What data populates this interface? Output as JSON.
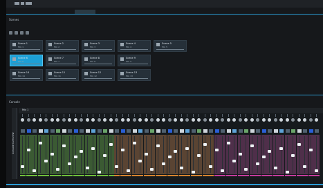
{
  "titlebar": {
    "logo": "logo-icon"
  },
  "tabs": [
    {
      "label": "",
      "active": false
    },
    {
      "label": "",
      "active": false
    },
    {
      "label": "",
      "active": false
    },
    {
      "label": "",
      "active": true
    }
  ],
  "upper": {
    "title": "Scenes",
    "toolbar": [
      "",
      "",
      "",
      "",
      "",
      "",
      "",
      ""
    ],
    "cards": [
      {
        "name": "Scene 1",
        "sub": "Mix 1",
        "selected": false
      },
      {
        "name": "Scene 2",
        "sub": "Mix 2",
        "selected": false
      },
      {
        "name": "Scene 3",
        "sub": "Mix 3",
        "selected": false
      },
      {
        "name": "Scene 4",
        "sub": "Mix 4",
        "selected": false
      },
      {
        "name": "Scene 5",
        "sub": "Mix 5",
        "selected": false
      },
      {
        "name": "Scene 6",
        "sub": "Mix 6",
        "selected": true
      },
      {
        "name": "Scene 7",
        "sub": "Mix 7",
        "selected": false
      },
      {
        "name": "Scene 8",
        "sub": "Mix 8",
        "selected": false
      },
      {
        "name": "Scene 9",
        "sub": "Mix 9",
        "selected": false
      },
      {
        "name": "Scene 10",
        "sub": "Mix 10",
        "selected": false
      },
      {
        "name": "Scene 11",
        "sub": "Mix 11",
        "selected": false
      },
      {
        "name": "Scene 12",
        "sub": "Mix 12",
        "selected": false
      },
      {
        "name": "Scene 13",
        "sub": "Mix 13",
        "selected": false
      },
      {
        "name": "Scene 14",
        "sub": "Mix 14",
        "selected": false
      }
    ]
  },
  "lower": {
    "title": "Console",
    "side_label": "Console Overview",
    "mixer_name": "Mix 1",
    "colors": {
      "green": "#3b5a33",
      "brown": "#5a4433",
      "purple": "#4f2f4a",
      "accent": "#2b9bd3"
    }
  }
}
